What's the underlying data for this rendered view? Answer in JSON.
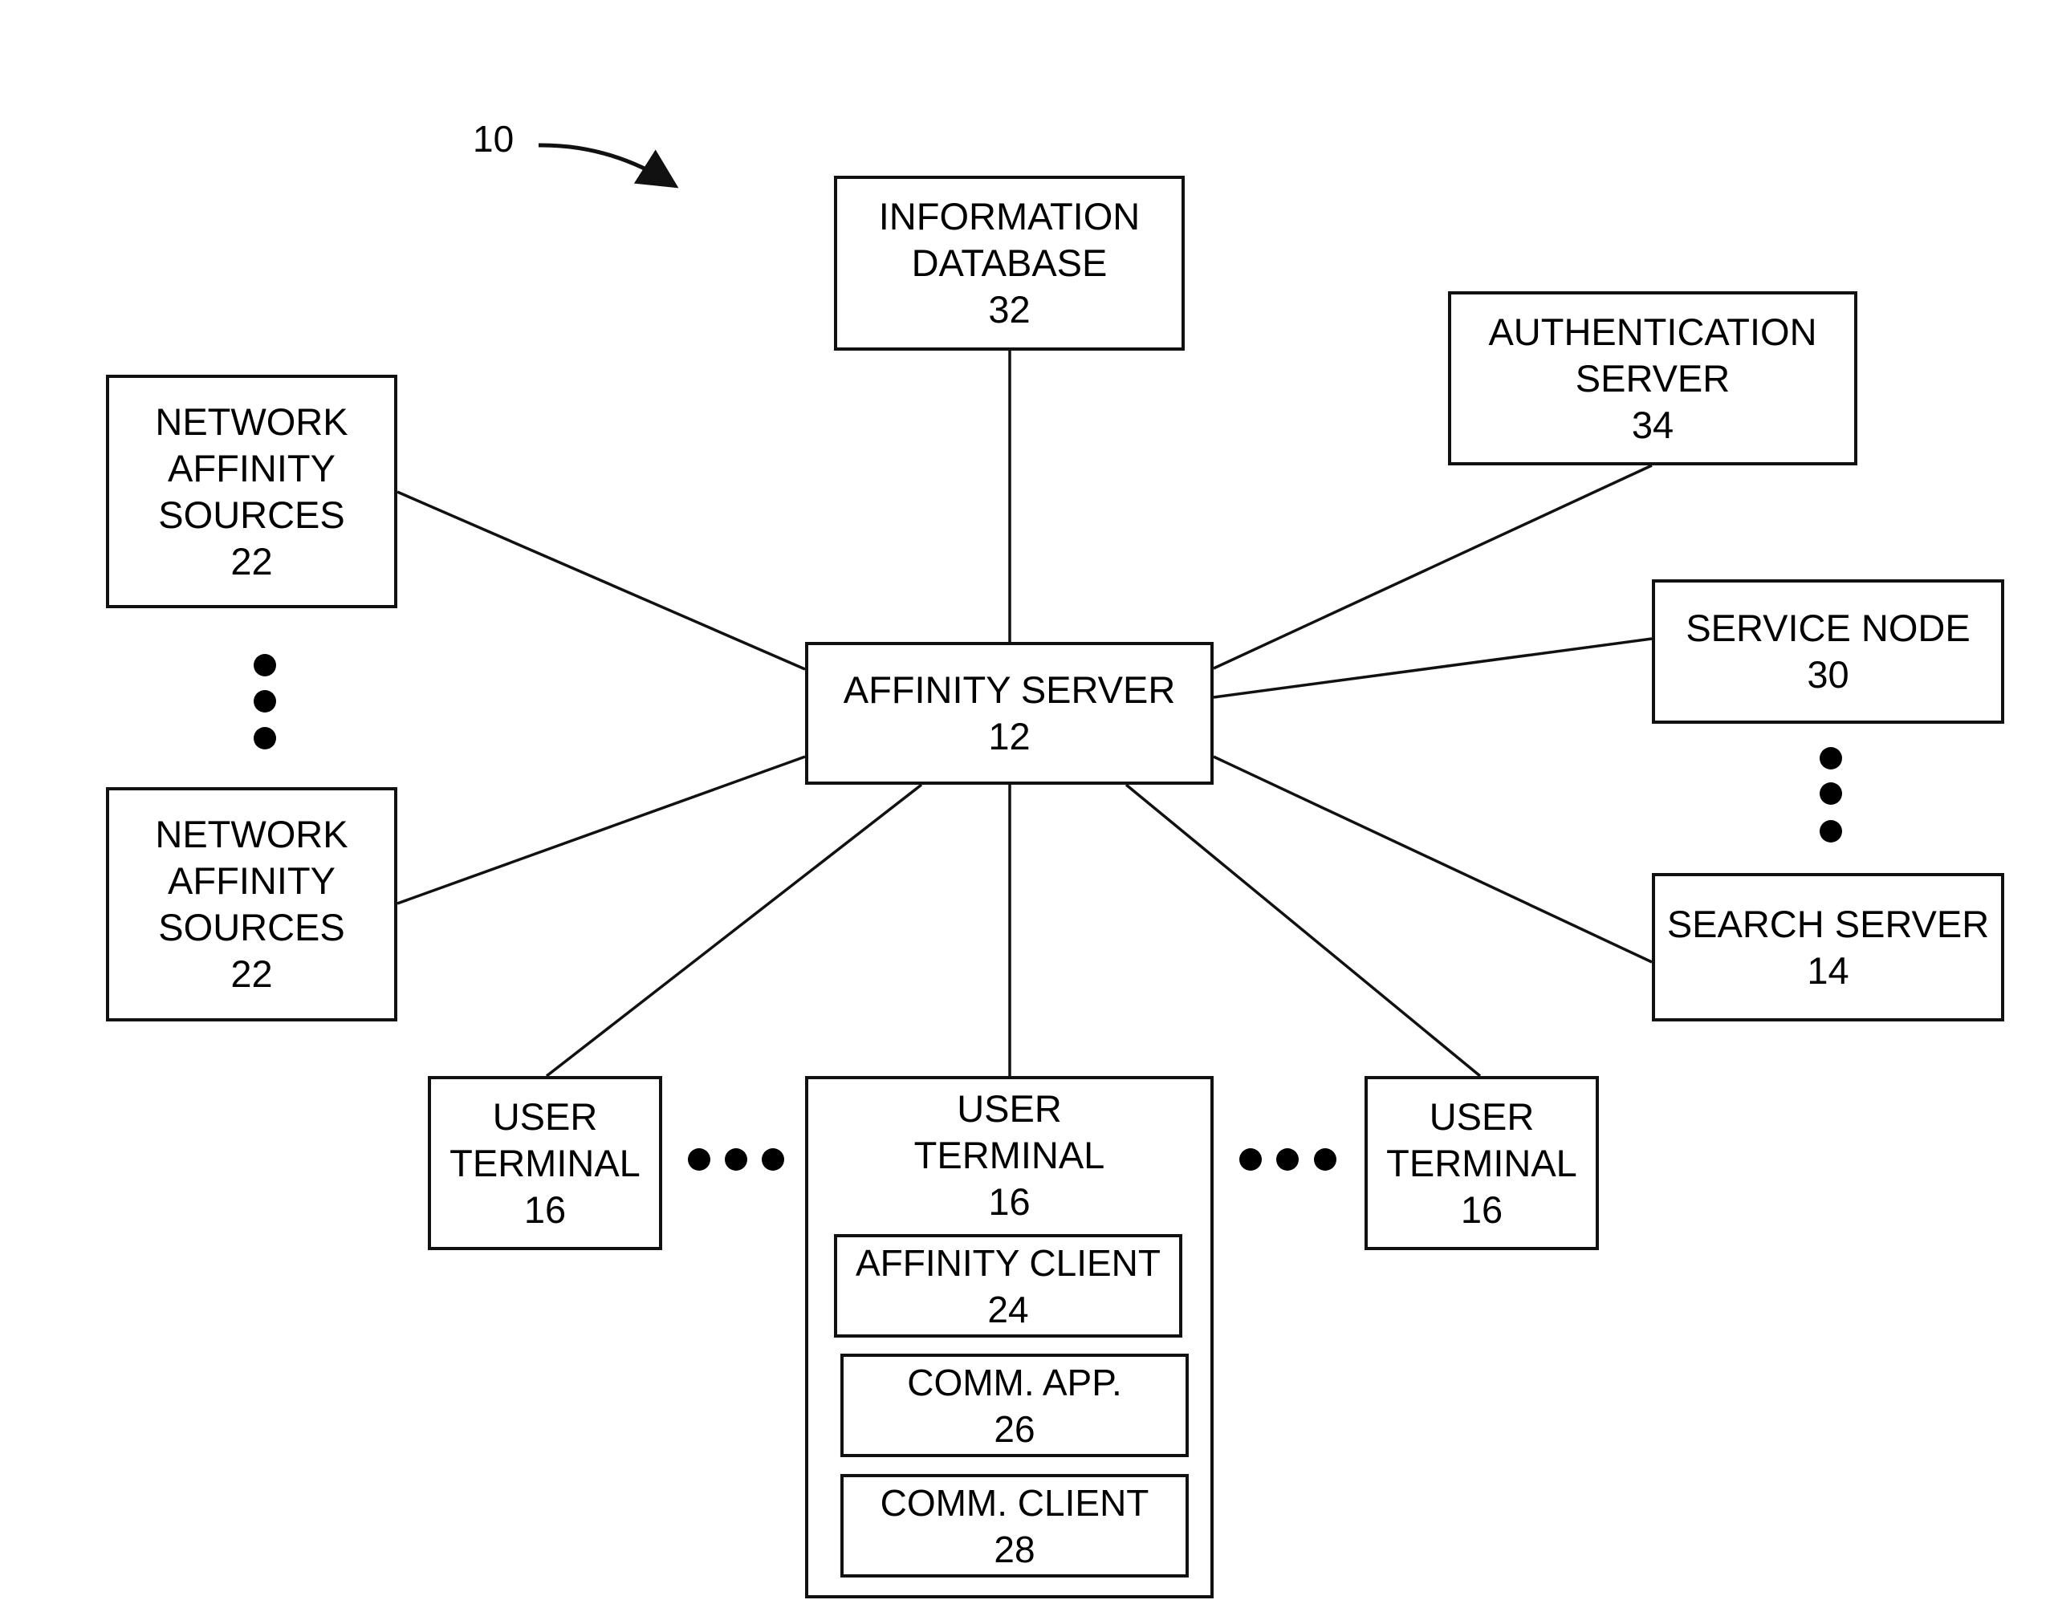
{
  "figure": {
    "reference_label": "10"
  },
  "nodes": {
    "information_database": {
      "lines": [
        "INFORMATION",
        "DATABASE"
      ],
      "ref": "32"
    },
    "authentication_server": {
      "lines": [
        "AUTHENTICATION",
        "SERVER"
      ],
      "ref": "34"
    },
    "network_affinity_sources_1": {
      "lines": [
        "NETWORK",
        "AFFINITY",
        "SOURCES"
      ],
      "ref": "22"
    },
    "network_affinity_sources_2": {
      "lines": [
        "NETWORK",
        "AFFINITY",
        "SOURCES"
      ],
      "ref": "22"
    },
    "affinity_server": {
      "lines": [
        "AFFINITY SERVER"
      ],
      "ref": "12"
    },
    "service_node": {
      "lines": [
        "SERVICE NODE"
      ],
      "ref": "30"
    },
    "search_server": {
      "lines": [
        "SEARCH SERVER"
      ],
      "ref": "14"
    },
    "user_terminal_left": {
      "lines": [
        "USER",
        "TERMINAL"
      ],
      "ref": "16"
    },
    "user_terminal_center": {
      "lines": [
        "USER",
        "TERMINAL"
      ],
      "ref": "16"
    },
    "user_terminal_right": {
      "lines": [
        "USER",
        "TERMINAL"
      ],
      "ref": "16"
    },
    "affinity_client": {
      "lines": [
        "AFFINITY CLIENT"
      ],
      "ref": "24"
    },
    "comm_app": {
      "lines": [
        "COMM. APP."
      ],
      "ref": "26"
    },
    "comm_client": {
      "lines": [
        "COMM. CLIENT"
      ],
      "ref": "28"
    }
  },
  "connections": [
    [
      "affinity_server",
      "information_database"
    ],
    [
      "affinity_server",
      "authentication_server"
    ],
    [
      "affinity_server",
      "network_affinity_sources_1"
    ],
    [
      "affinity_server",
      "network_affinity_sources_2"
    ],
    [
      "affinity_server",
      "service_node"
    ],
    [
      "affinity_server",
      "search_server"
    ],
    [
      "affinity_server",
      "user_terminal_left"
    ],
    [
      "affinity_server",
      "user_terminal_center"
    ],
    [
      "affinity_server",
      "user_terminal_right"
    ]
  ],
  "ellipses": [
    "between network affinity sources",
    "between service node and search server",
    "between left and center user terminals",
    "between center and right user terminals"
  ]
}
